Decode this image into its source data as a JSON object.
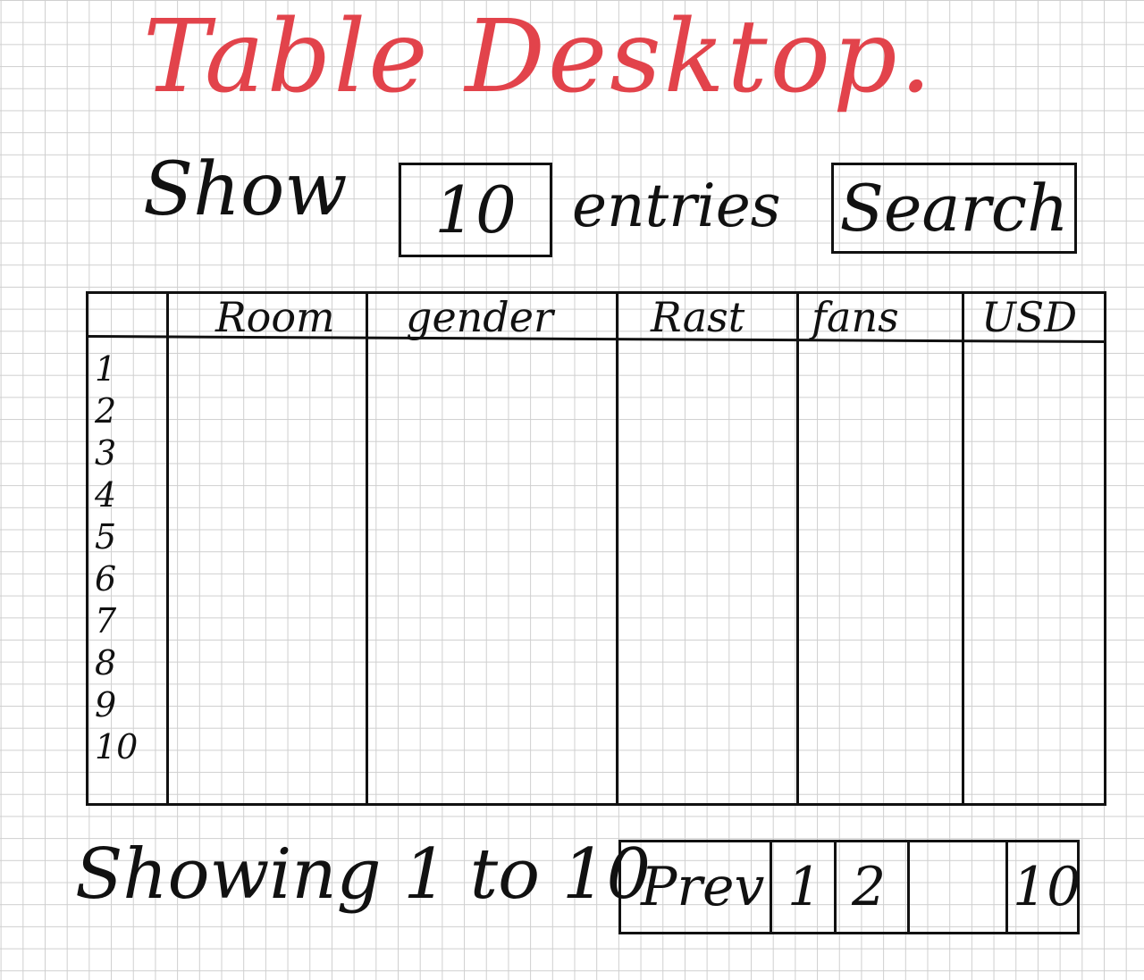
{
  "sheet": {
    "title": "Table Desktop."
  },
  "controls": {
    "show_label": "Show",
    "entries_value": "10",
    "entries_label": "entries",
    "search_label": "Search"
  },
  "table": {
    "columns": [
      "Room",
      "gender",
      "Rast",
      "fans",
      "USD"
    ],
    "row_numbers": [
      "1",
      "2",
      "3",
      "4",
      "5",
      "6",
      "7",
      "8",
      "9",
      "10"
    ]
  },
  "footer": {
    "info": "Showing 1 to 10",
    "pagination": {
      "prev": "Prev",
      "pages": [
        "1",
        "2",
        "10"
      ]
    }
  },
  "colors": {
    "title": "#e2434b",
    "ink": "#111111",
    "grid": "#cfcfcf"
  }
}
